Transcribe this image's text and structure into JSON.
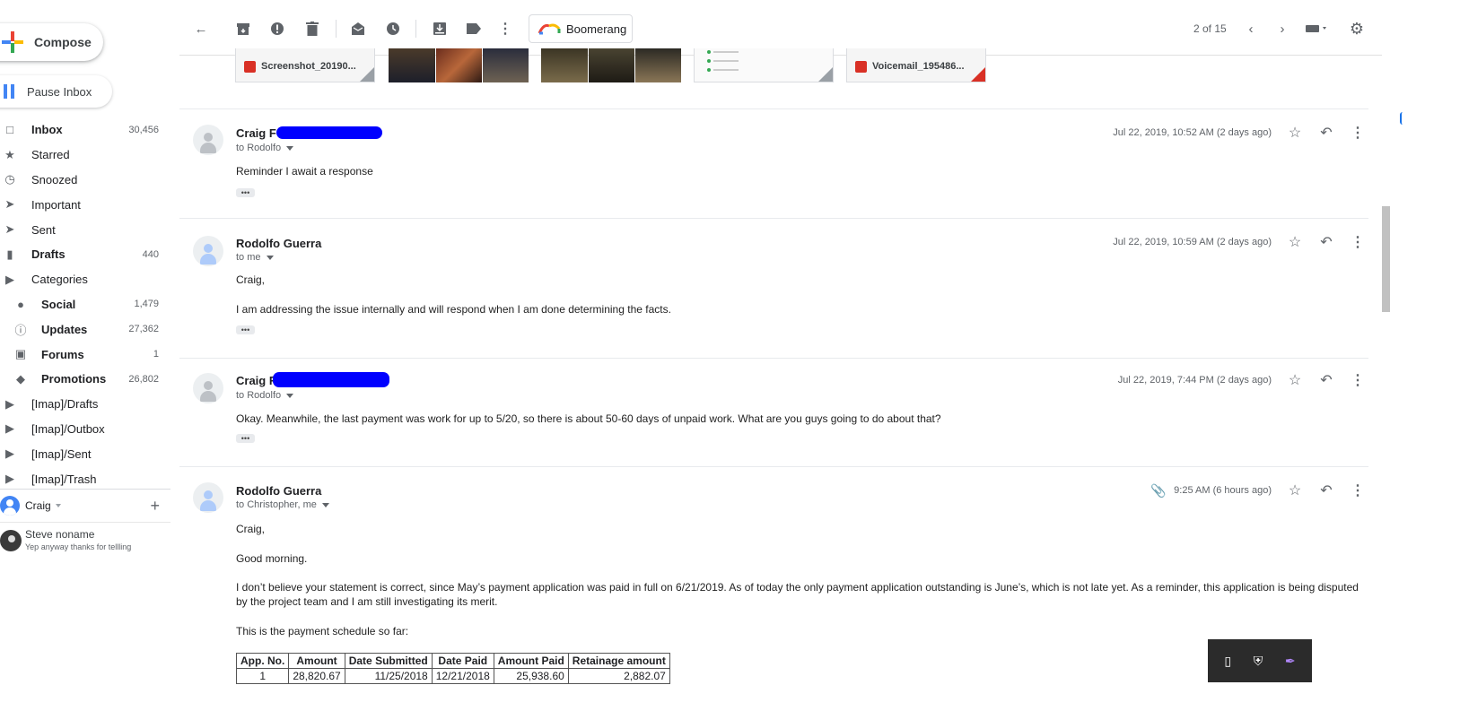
{
  "compose": {
    "label": "Compose"
  },
  "pause": {
    "label": "Pause Inbox"
  },
  "nav": [
    {
      "label": "Inbox",
      "count": "30,456",
      "icon": "inbox-icon",
      "bold": true,
      "sub": false
    },
    {
      "label": "Starred",
      "count": "",
      "icon": "star-icon",
      "bold": false,
      "sub": false
    },
    {
      "label": "Snoozed",
      "count": "",
      "icon": "clock-icon",
      "bold": false,
      "sub": false
    },
    {
      "label": "Important",
      "count": "",
      "icon": "important-icon",
      "bold": false,
      "sub": false
    },
    {
      "label": "Sent",
      "count": "",
      "icon": "send-icon",
      "bold": false,
      "sub": false
    },
    {
      "label": "Drafts",
      "count": "440",
      "icon": "draft-icon",
      "bold": true,
      "sub": false
    },
    {
      "label": "Categories",
      "count": "",
      "icon": "label-icon",
      "bold": false,
      "sub": false
    },
    {
      "label": "Social",
      "count": "1,479",
      "icon": "people-icon",
      "bold": true,
      "sub": true
    },
    {
      "label": "Updates",
      "count": "27,362",
      "icon": "info-icon",
      "bold": true,
      "sub": true
    },
    {
      "label": "Forums",
      "count": "1",
      "icon": "forum-icon",
      "bold": true,
      "sub": true
    },
    {
      "label": "Promotions",
      "count": "26,802",
      "icon": "tag-icon",
      "bold": true,
      "sub": true
    },
    {
      "label": "[Imap]/Drafts",
      "count": "",
      "icon": "label-icon",
      "bold": false,
      "sub": false
    },
    {
      "label": "[Imap]/Outbox",
      "count": "",
      "icon": "label-icon",
      "bold": false,
      "sub": false
    },
    {
      "label": "[Imap]/Sent",
      "count": "",
      "icon": "label-icon",
      "bold": false,
      "sub": false
    },
    {
      "label": "[Imap]/Trash",
      "count": "",
      "icon": "label-icon",
      "bold": false,
      "sub": false
    }
  ],
  "hangouts": {
    "me": "Craig",
    "contact_name": "Steve noname",
    "contact_status": "Yep anyway thanks for tellling"
  },
  "toolbar": {
    "boomerang": "Boomerang",
    "pager": "2 of 15"
  },
  "attachments": [
    {
      "name": "Screenshot_20190...",
      "type": "image"
    },
    {
      "name": "Voicemail_195486...",
      "type": "audio"
    }
  ],
  "messages": [
    {
      "sender": "Craig F",
      "to": "to Rodolfo",
      "date": "Jul 22, 2019, 10:52 AM (2 days ago)",
      "body": [
        "Reminder I await a response"
      ]
    },
    {
      "sender": "Rodolfo Guerra",
      "to": "to me",
      "date": "Jul 22, 2019, 10:59 AM (2 days ago)",
      "body": [
        "Craig,",
        "I am addressing the issue internally and will respond when I am done determining the facts."
      ]
    },
    {
      "sender": "Craig F",
      "to": "to Rodolfo",
      "date": "Jul 22, 2019, 7:44 PM (2 days ago)",
      "body": [
        "Okay.  Meanwhile, the last payment was work for up to 5/20, so there is about 50-60 days of unpaid work. What are you guys going to do about that?"
      ]
    },
    {
      "sender": "Rodolfo Guerra",
      "to": "to Christopher, me",
      "date": "9:25 AM (6 hours ago)",
      "body": [
        "Craig,",
        "Good morning.",
        "I don’t believe your statement is correct, since May’s payment application was paid in full on 6/21/2019.  As of today the only payment application outstanding is June’s, which is not late yet.  As a reminder, this application is being disputed by the project team and I am still investigating its merit.",
        "This is the payment schedule so far:"
      ]
    }
  ],
  "payment_table": {
    "headers": [
      "App. No.",
      "Amount",
      "Date Submitted",
      "Date Paid",
      "Amount Paid",
      "Retainage amount"
    ],
    "rows": [
      [
        "1",
        "28,820.67",
        "11/25/2018",
        "12/21/2018",
        "25,938.60",
        "2,882.07"
      ]
    ]
  },
  "colors": {
    "accent_blue": "#4285f4",
    "redaction": "#0000ff"
  }
}
